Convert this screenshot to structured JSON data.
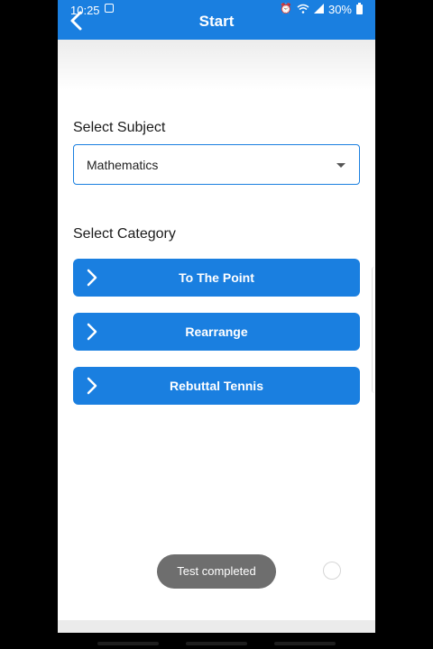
{
  "status_bar": {
    "time": "10:25",
    "battery": "30%",
    "icons": [
      "screenshot-icon",
      "alarm-icon",
      "wifi-icon",
      "signal-icon",
      "battery-icon"
    ]
  },
  "header": {
    "title": "Start",
    "back_icon": "chevron-left-icon",
    "color": "#1a7fe0"
  },
  "subject": {
    "label": "Select Subject",
    "selected": "Mathematics"
  },
  "category": {
    "label": "Select Category",
    "buttons": [
      {
        "label": "To The Point",
        "icon": "chevron-right-icon"
      },
      {
        "label": "Rearrange",
        "icon": "chevron-right-icon"
      },
      {
        "label": "Rebuttal Tennis",
        "icon": "chevron-right-icon"
      }
    ]
  },
  "toast": {
    "message": "Test completed"
  }
}
